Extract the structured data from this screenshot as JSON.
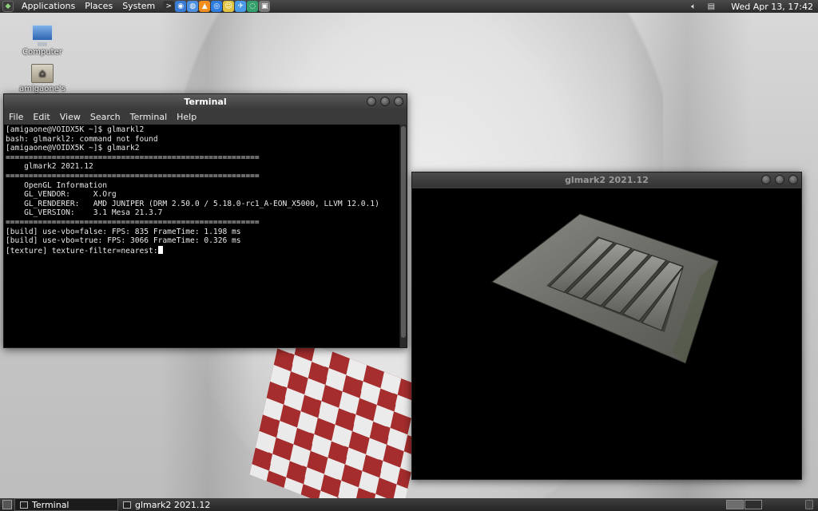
{
  "top_panel": {
    "menus": [
      "Applications",
      "Places",
      "System"
    ],
    "clock": "Wed Apr 13, 17:42",
    "launchers": [
      {
        "name": "terminal-launcher-icon",
        "color": "#333333",
        "glyph": ">"
      },
      {
        "name": "network-launcher-icon",
        "color": "#3a7bd5",
        "glyph": "◉"
      },
      {
        "name": "web-launcher-icon",
        "color": "#4d8fe0",
        "glyph": "◍"
      },
      {
        "name": "vlc-launcher-icon",
        "color": "#f28c1a",
        "glyph": "▲"
      },
      {
        "name": "chrome-launcher-icon",
        "color": "#2e7de0",
        "glyph": "◎"
      },
      {
        "name": "smiley-launcher-icon",
        "color": "#e0c341",
        "glyph": "☺"
      },
      {
        "name": "bird-launcher-icon",
        "color": "#4a9ae8",
        "glyph": "✈"
      },
      {
        "name": "globe-launcher-icon",
        "color": "#35a06b",
        "glyph": "◌"
      },
      {
        "name": "image-launcher-icon",
        "color": "#7a7a7a",
        "glyph": "▣"
      }
    ]
  },
  "desktop": {
    "icons": [
      {
        "label": "Computer"
      },
      {
        "label": "amigaone's"
      }
    ]
  },
  "terminal": {
    "title": "Terminal",
    "menu": [
      "File",
      "Edit",
      "View",
      "Search",
      "Terminal",
      "Help"
    ],
    "lines": [
      "[amigaone@VOIDX5K ~]$ glmarkl2",
      "bash: glmarkl2: command not found",
      "[amigaone@VOIDX5K ~]$ glmark2",
      "=======================================================",
      "    glmark2 2021.12",
      "=======================================================",
      "    OpenGL Information",
      "    GL_VENDOR:     X.Org",
      "    GL_RENDERER:   AMD JUNIPER (DRM 2.50.0 / 5.18.0-rc1_A-EON_X5000, LLVM 12.0.1)",
      "    GL_VERSION:    3.1 Mesa 21.3.7",
      "=======================================================",
      "[build] use-vbo=false: FPS: 835 FrameTime: 1.198 ms",
      "[build] use-vbo=true: FPS: 3066 FrameTime: 0.326 ms",
      "[texture] texture-filter=nearest:"
    ]
  },
  "glmark_window": {
    "title": "glmark2 2021.12"
  },
  "taskbar": {
    "tasks": [
      {
        "label": "Terminal",
        "active": true
      },
      {
        "label": "glmark2 2021.12",
        "active": false
      }
    ]
  }
}
